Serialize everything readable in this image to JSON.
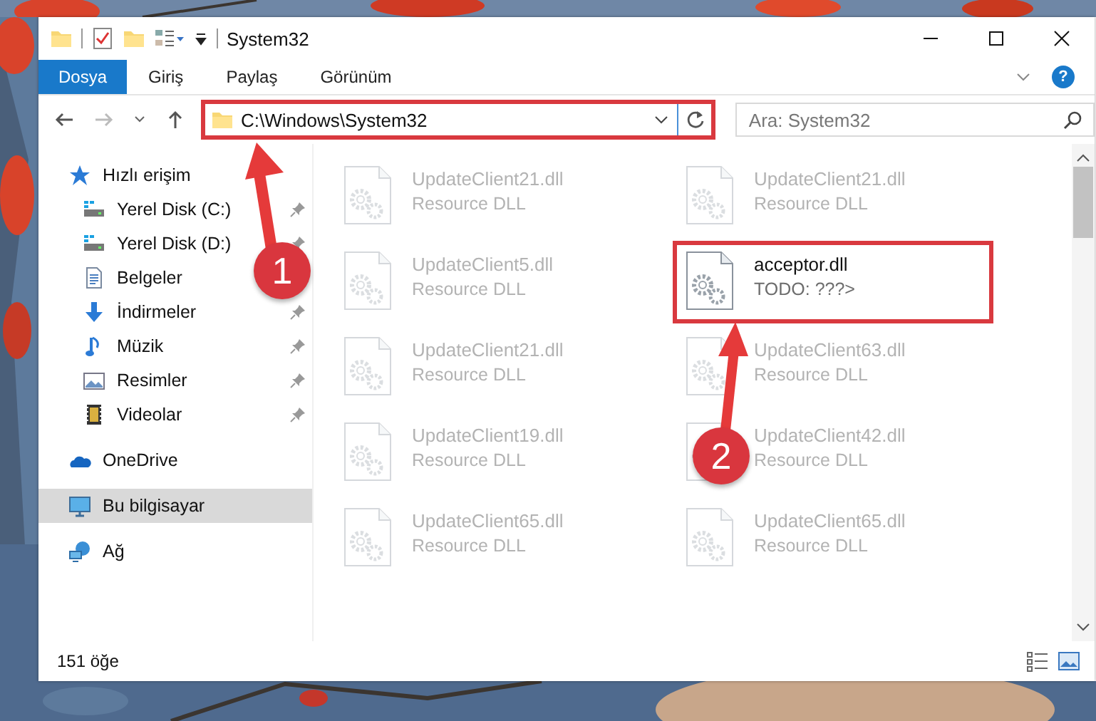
{
  "window": {
    "title": "System32"
  },
  "ribbon": {
    "tabs": [
      {
        "label": "Dosya",
        "selected": true
      },
      {
        "label": "Giriş",
        "selected": false
      },
      {
        "label": "Paylaş",
        "selected": false
      },
      {
        "label": "Görünüm",
        "selected": false
      }
    ],
    "help": "?"
  },
  "address": {
    "path": "C:\\Windows\\System32",
    "highlighted": true
  },
  "search": {
    "placeholder": "Ara: System32"
  },
  "sidebar": {
    "items": [
      {
        "label": "Hızlı erişim",
        "kind": "star",
        "selected": false,
        "children": [
          {
            "label": "Yerel Disk (C:)",
            "kind": "drive",
            "pinned": true
          },
          {
            "label": "Yerel Disk (D:)",
            "kind": "drive",
            "pinned": true
          },
          {
            "label": "Belgeler",
            "kind": "documents",
            "pinned": false
          },
          {
            "label": "İndirmeler",
            "kind": "download",
            "pinned": true
          },
          {
            "label": "Müzik",
            "kind": "music",
            "pinned": true
          },
          {
            "label": "Resimler",
            "kind": "pictures",
            "pinned": true
          },
          {
            "label": "Videolar",
            "kind": "videos",
            "pinned": true
          }
        ]
      },
      {
        "label": "OneDrive",
        "kind": "cloud",
        "selected": false
      },
      {
        "label": "Bu bilgisayar",
        "kind": "computer",
        "selected": true
      },
      {
        "label": "Ağ",
        "kind": "network",
        "selected": false
      }
    ]
  },
  "files": [
    {
      "name": "UpdateClient21.dll",
      "type": "Resource DLL",
      "dimmed": true,
      "highlighted": false
    },
    {
      "name": "UpdateClient21.dll",
      "type": "Resource DLL",
      "dimmed": true,
      "highlighted": false
    },
    {
      "name": "UpdateClient5.dll",
      "type": "Resource DLL",
      "dimmed": true,
      "highlighted": false
    },
    {
      "name": "acceptor.dll",
      "type": "TODO: ???>",
      "dimmed": false,
      "highlighted": true
    },
    {
      "name": "UpdateClient21.dll",
      "type": "Resource DLL",
      "dimmed": true,
      "highlighted": false
    },
    {
      "name": "UpdateClient63.dll",
      "type": "Resource DLL",
      "dimmed": true,
      "highlighted": false
    },
    {
      "name": "UpdateClient19.dll",
      "type": "Resource DLL",
      "dimmed": true,
      "highlighted": false
    },
    {
      "name": "UpdateClient42.dll",
      "type": "Resource DLL",
      "dimmed": true,
      "highlighted": false
    },
    {
      "name": "UpdateClient65.dll",
      "type": "Resource DLL",
      "dimmed": true,
      "highlighted": false
    },
    {
      "name": "UpdateClient65.dll",
      "type": "Resource DLL",
      "dimmed": true,
      "highlighted": false
    }
  ],
  "status_bar": {
    "count": "151 öğe"
  },
  "annotations": [
    {
      "number": "1"
    },
    {
      "number": "2"
    }
  ]
}
